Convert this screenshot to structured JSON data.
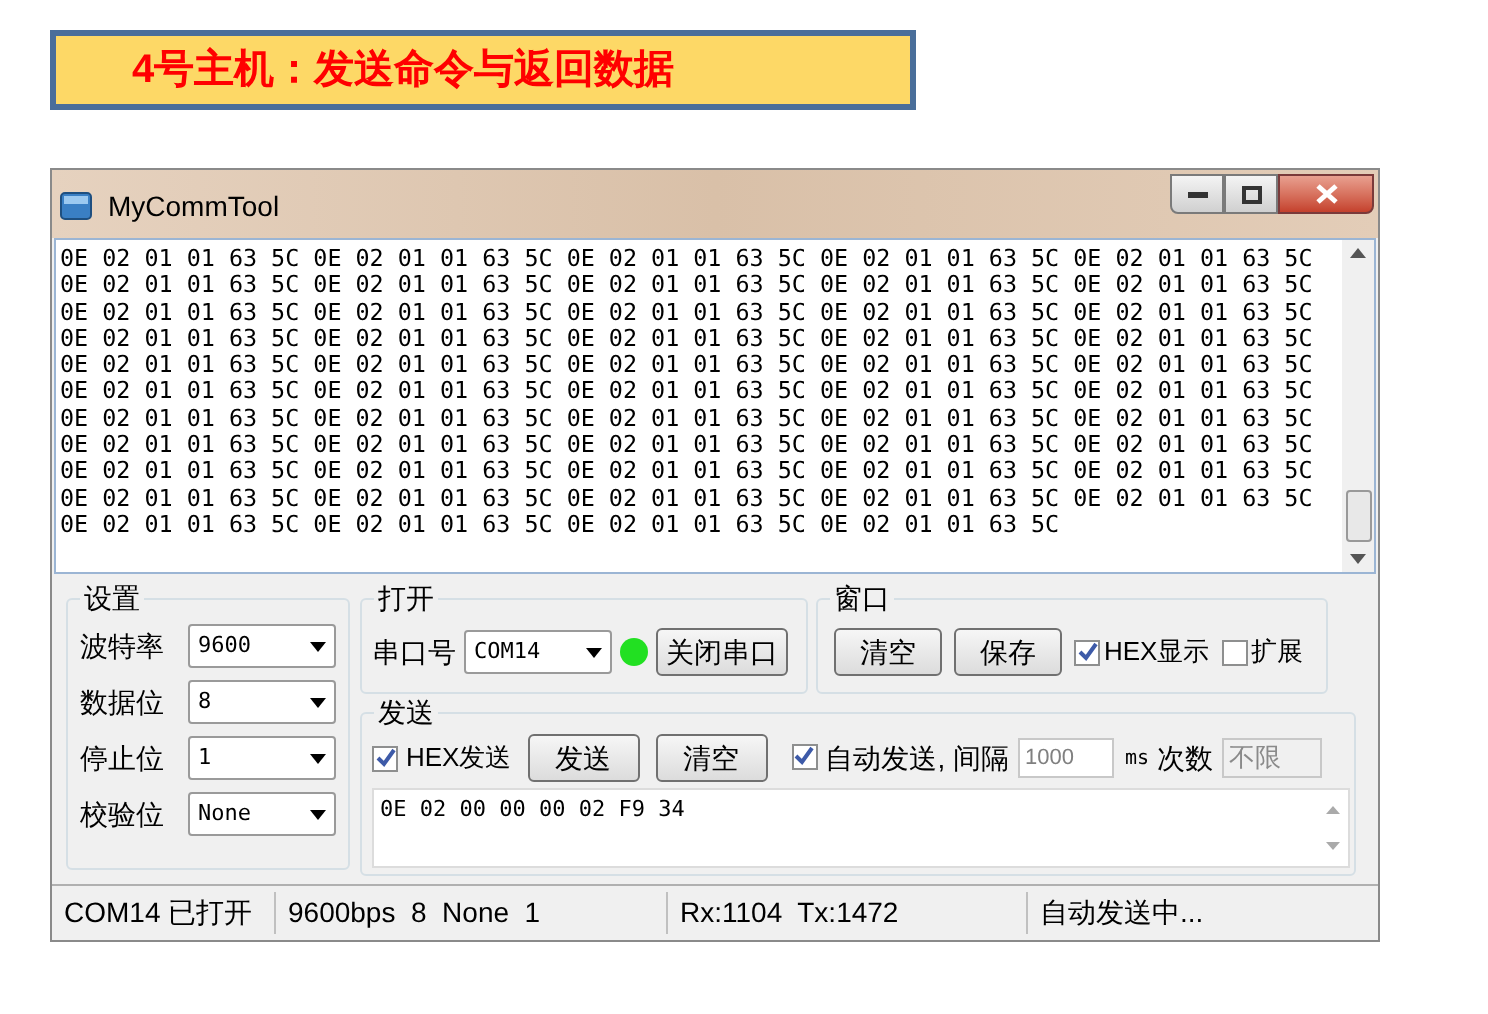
{
  "banner": {
    "title": "4号主机：发送命令与返回数据"
  },
  "window": {
    "title": "MyCommTool"
  },
  "receive": {
    "lines": [
      "0E 02 01 01 63 5C 0E 02 01 01 63 5C 0E 02 01 01 63 5C 0E 02 01 01 63 5C 0E 02 01 01 63 5C",
      "0E 02 01 01 63 5C 0E 02 01 01 63 5C 0E 02 01 01 63 5C 0E 02 01 01 63 5C 0E 02 01 01 63 5C",
      "0E 02 01 01 63 5C 0E 02 01 01 63 5C 0E 02 01 01 63 5C 0E 02 01 01 63 5C 0E 02 01 01 63 5C",
      "0E 02 01 01 63 5C 0E 02 01 01 63 5C 0E 02 01 01 63 5C 0E 02 01 01 63 5C 0E 02 01 01 63 5C",
      "0E 02 01 01 63 5C 0E 02 01 01 63 5C 0E 02 01 01 63 5C 0E 02 01 01 63 5C 0E 02 01 01 63 5C",
      "0E 02 01 01 63 5C 0E 02 01 01 63 5C 0E 02 01 01 63 5C 0E 02 01 01 63 5C 0E 02 01 01 63 5C",
      "0E 02 01 01 63 5C 0E 02 01 01 63 5C 0E 02 01 01 63 5C 0E 02 01 01 63 5C 0E 02 01 01 63 5C",
      "0E 02 01 01 63 5C 0E 02 01 01 63 5C 0E 02 01 01 63 5C 0E 02 01 01 63 5C 0E 02 01 01 63 5C",
      "0E 02 01 01 63 5C 0E 02 01 01 63 5C 0E 02 01 01 63 5C 0E 02 01 01 63 5C 0E 02 01 01 63 5C",
      "0E 02 01 01 63 5C 0E 02 01 01 63 5C 0E 02 01 01 63 5C 0E 02 01 01 63 5C 0E 02 01 01 63 5C",
      "0E 02 01 01 63 5C 0E 02 01 01 63 5C 0E 02 01 01 63 5C 0E 02 01 01 63 5C"
    ]
  },
  "settings": {
    "title": "设置",
    "fields": [
      {
        "label": "波特率",
        "value": "9600"
      },
      {
        "label": "数据位",
        "value": "8"
      },
      {
        "label": "停止位",
        "value": "1"
      },
      {
        "label": "校验位",
        "value": "None"
      }
    ]
  },
  "open": {
    "title": "打开",
    "port_label": "串口号",
    "port": "COM14",
    "port_open": true,
    "button": "关闭串口"
  },
  "window_group": {
    "title": "窗口",
    "buttons": [
      "清空",
      "保存"
    ],
    "checkboxes": [
      {
        "label": "HEX显示",
        "checked": true
      },
      {
        "label": "扩展",
        "checked": false
      }
    ]
  },
  "send": {
    "title": "发送",
    "hex": {
      "label": "HEX发送",
      "checked": true
    },
    "buttons": [
      "发送",
      "清空"
    ],
    "auto": {
      "label": "自动发送, 间隔",
      "checked": true
    },
    "interval": "1000",
    "unit": "ms",
    "count_label": "次数",
    "count": {
      "value": "不限",
      "disabled": true
    },
    "text": "0E 02 00 00 00 02 F9 34"
  },
  "status_bar": [
    "COM14 已打开",
    "9600bps  8  None  1",
    "Rx:1104  Tx:1472",
    "自动发送中..."
  ]
}
